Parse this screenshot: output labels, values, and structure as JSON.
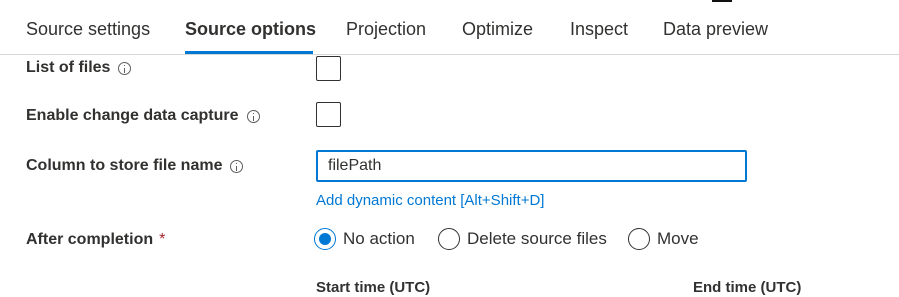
{
  "tabs": [
    {
      "label": "Source settings",
      "active": false
    },
    {
      "label": "Source options",
      "active": true
    },
    {
      "label": "Projection",
      "active": false
    },
    {
      "label": "Optimize",
      "active": false
    },
    {
      "label": "Inspect",
      "active": false
    },
    {
      "label": "Data preview",
      "active": false
    }
  ],
  "form": {
    "list_of_files": {
      "label": "List of files",
      "checked": false
    },
    "change_data_capture": {
      "label": "Enable change data capture",
      "checked": false
    },
    "column_file_name": {
      "label": "Column to store file name",
      "value": "filePath"
    },
    "dynamic_content_link": "Add dynamic content [Alt+Shift+D]",
    "after_completion": {
      "label": "After completion",
      "required_mark": "*",
      "options": [
        "No action",
        "Delete source files",
        "Move"
      ],
      "selected": "No action"
    },
    "start_time_label": "Start time (UTC)",
    "end_time_label": "End time (UTC)"
  },
  "colors": {
    "accent": "#0078d4",
    "required": "#a4262c",
    "text": "#323130"
  }
}
